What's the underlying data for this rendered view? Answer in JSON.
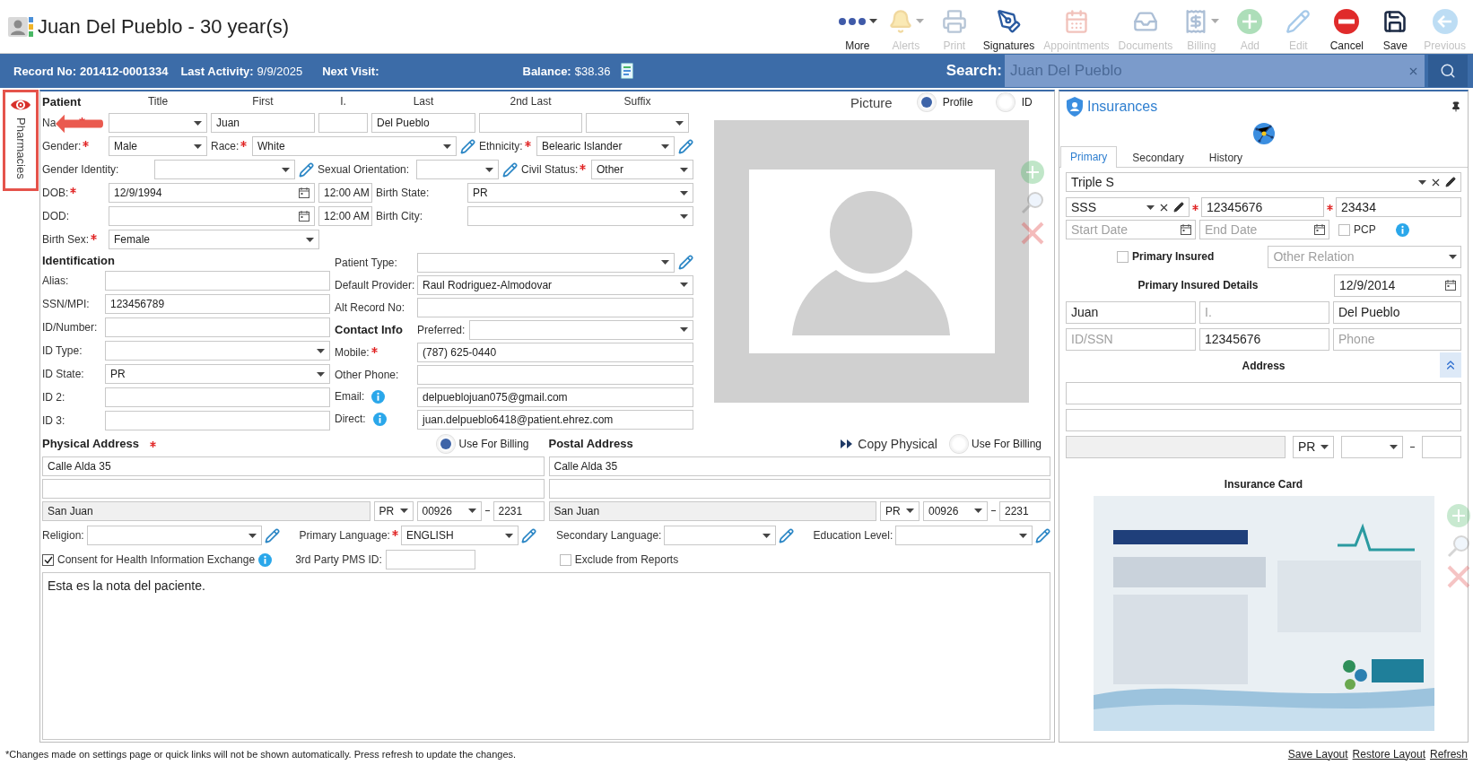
{
  "header": {
    "title": "Juan Del Pueblo - 30 year(s)"
  },
  "toolbar": [
    {
      "label": "More",
      "kind": "more",
      "disabled": false,
      "dropdown": true
    },
    {
      "label": "Alerts",
      "kind": "alerts",
      "disabled": true,
      "dropdown": true
    },
    {
      "label": "Print",
      "kind": "print",
      "disabled": true,
      "dropdown": false
    },
    {
      "label": "Signatures",
      "kind": "signatures",
      "disabled": false,
      "dropdown": false
    },
    {
      "label": "Appointments",
      "kind": "appointments",
      "disabled": true,
      "dropdown": false
    },
    {
      "label": "Documents",
      "kind": "documents",
      "disabled": true,
      "dropdown": false
    },
    {
      "label": "Billing",
      "kind": "billing",
      "disabled": true,
      "dropdown": true
    },
    {
      "label": "Add",
      "kind": "add",
      "disabled": true,
      "dropdown": false
    },
    {
      "label": "Edit",
      "kind": "edit",
      "disabled": true,
      "dropdown": false
    },
    {
      "label": "Cancel",
      "kind": "cancel",
      "disabled": false,
      "dropdown": false
    },
    {
      "label": "Save",
      "kind": "save",
      "disabled": false,
      "dropdown": false
    },
    {
      "label": "Previous",
      "kind": "previous",
      "disabled": true,
      "dropdown": false
    }
  ],
  "info_bar": {
    "record": {
      "label": "Record No:",
      "value": "201412-0001334"
    },
    "last_activity": {
      "label": "Last Activity:",
      "value": "9/9/2025"
    },
    "next_visit": {
      "label": "Next Visit:"
    },
    "balance": {
      "label": "Balance:",
      "value": "$38.36"
    },
    "search": {
      "label": "Search:",
      "value": "Juan Del Pueblo"
    }
  },
  "side_tabs": [
    {
      "label": "Pharmacies"
    }
  ],
  "patient": {
    "heading": "Patient",
    "name_columns": [
      "Title",
      "First",
      "I.",
      "Last",
      "2nd Last",
      "Suffix"
    ],
    "name": {
      "label": "Na",
      "required": true,
      "first": "Juan",
      "last": "Del Pueblo"
    },
    "gender": {
      "label": "Gender:",
      "required": true,
      "value": "Male"
    },
    "race": {
      "label": "Race:",
      "required": true,
      "value": "White"
    },
    "ethnicity": {
      "label": "Ethnicity:",
      "required": true,
      "value": "Belearic Islander"
    },
    "gender_identity": {
      "label": "Gender Identity:",
      "required": false
    },
    "sexual_orientation": {
      "label": "Sexual Orientation:",
      "required": false
    },
    "civil_status": {
      "label": "Civil Status:",
      "required": true,
      "value": "Other"
    },
    "dob": {
      "label": "DOB:",
      "required": true,
      "value": "12/9/1994",
      "time": "12:00 AM"
    },
    "birth_state": {
      "label": "Birth State:",
      "required": false,
      "value": "PR"
    },
    "dod": {
      "label": "DOD:",
      "required": false,
      "time": "12:00 AM"
    },
    "birth_city": {
      "label": "Birth City:",
      "required": false
    },
    "birth_sex": {
      "label": "Birth Sex:",
      "required": true,
      "value": "Female"
    }
  },
  "identification": {
    "heading": "Identification",
    "fields": [
      {
        "label": "Alias:",
        "kind": "text"
      },
      {
        "label": "SSN/MPI:",
        "kind": "text",
        "value": "123456789"
      },
      {
        "label": "ID/Number:",
        "kind": "text"
      },
      {
        "label": "ID Type:",
        "kind": "select"
      },
      {
        "label": "ID State:",
        "kind": "select",
        "value": "PR"
      },
      {
        "label": "ID 2:",
        "kind": "text"
      },
      {
        "label": "ID 3:",
        "kind": "text"
      }
    ]
  },
  "patient_type": {
    "label": "Patient Type:"
  },
  "default_provider": {
    "label": "Default Provider:",
    "value": "Raul Rodriguez-Almodovar"
  },
  "alt_record": {
    "label": "Alt Record No:"
  },
  "contact": {
    "heading": "Contact Info",
    "preferred_label": "Preferred:",
    "fields": [
      {
        "label": "Mobile:",
        "required": true,
        "info": false,
        "value": "(787) 625-0440"
      },
      {
        "label": "Other Phone:",
        "required": false,
        "info": false
      },
      {
        "label": "Email:",
        "required": false,
        "info": true,
        "value": "delpueblojuan075@gmail.com"
      },
      {
        "label": "Direct:",
        "required": false,
        "info": true,
        "value": "juan.delpueblo6418@patient.ehrez.com"
      }
    ]
  },
  "picture": {
    "heading": "Picture",
    "options": [
      {
        "label": "Profile",
        "selected": true
      },
      {
        "label": "ID",
        "selected": false
      }
    ]
  },
  "physical_address": {
    "heading": "Physical Address",
    "required": true,
    "billing_label": "Use For Billing",
    "use_for_billing": true,
    "line1": "Calle Alda 35",
    "city": "San Juan",
    "state": "PR",
    "zip": "00926",
    "zip_ext": "2231"
  },
  "postal_address": {
    "heading": "Postal Address",
    "copy_label": "Copy Physical",
    "billing_label": "Use For Billing",
    "use_for_billing": false,
    "line1": "Calle Alda 35",
    "city": "San Juan",
    "state": "PR",
    "zip": "00926",
    "zip_ext": "2231"
  },
  "demographics": [
    {
      "label": "Religion:",
      "required": false
    },
    {
      "label": "Primary Language:",
      "required": true,
      "value": "ENGLISH"
    },
    {
      "label": "Secondary Language:",
      "required": false
    },
    {
      "label": "Education Level:",
      "required": false
    }
  ],
  "consent": {
    "label": "Consent for Health Information Exchange",
    "checked": true
  },
  "third_party": {
    "label": "3rd Party PMS ID:"
  },
  "exclude": {
    "label": "Exclude from Reports",
    "checked": false
  },
  "notes": "Esta es la nota del paciente.",
  "insurances": {
    "title": "Insurances",
    "tabs": [
      {
        "label": "Primary",
        "selected": true
      },
      {
        "label": "Secondary",
        "selected": false
      },
      {
        "label": "History",
        "selected": false
      }
    ],
    "plan": "Triple S",
    "sub_plan": "SSS",
    "member_id": {
      "value": "12345676",
      "required": true
    },
    "group": {
      "value": "23434",
      "required": true
    },
    "start_date": {
      "placeholder": "Start Date"
    },
    "end_date": {
      "placeholder": "End Date"
    },
    "pcp": {
      "label": "PCP",
      "checked": false
    },
    "primary_insured": {
      "label": "Primary Insured",
      "checked": false
    },
    "relation": {
      "placeholder": "Other Relation"
    },
    "details_heading": "Primary Insured Details",
    "insured_dob": "12/9/2014",
    "insured_first": "Juan",
    "insured_initial": {
      "placeholder": "I."
    },
    "insured_last": "Del Pueblo",
    "insured_id": {
      "placeholder": "ID/SSN"
    },
    "insured_number": "12345676",
    "insured_phone": {
      "placeholder": "Phone"
    },
    "address_heading": "Address",
    "address_state": "PR",
    "card_heading": "Insurance Card"
  },
  "footer": {
    "note": "*Changes made on settings page or quick links will not be shown automatically. Press refresh to update the changes.",
    "links": [
      "Save Layout",
      "Restore Layout",
      "Refresh"
    ]
  }
}
